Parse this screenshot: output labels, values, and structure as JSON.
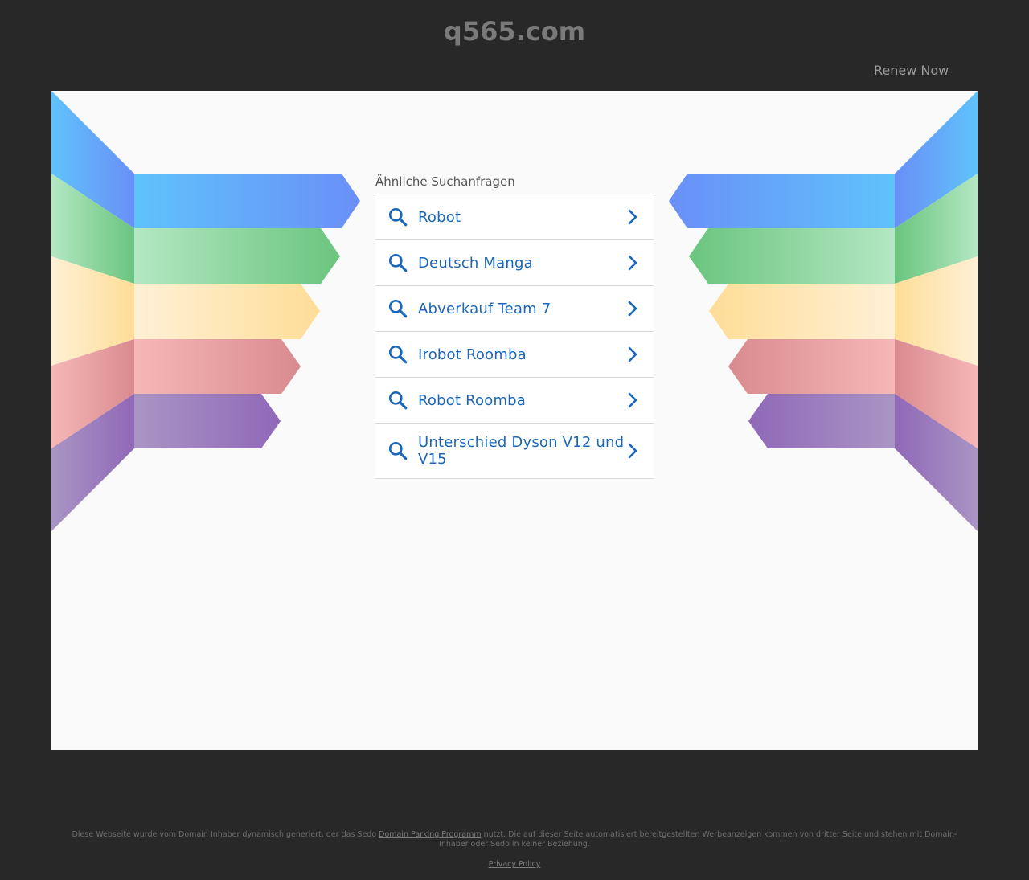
{
  "domain": "q565.com",
  "renew_label": "Renew Now",
  "related": {
    "heading": "Ähnliche Suchanfragen",
    "items": [
      {
        "label": "Robot"
      },
      {
        "label": "Deutsch Manga"
      },
      {
        "label": "Abverkauf Team 7"
      },
      {
        "label": "Irobot Roomba"
      },
      {
        "label": "Robot Roomba"
      },
      {
        "label": "Unterschied Dyson V12 und V15"
      }
    ]
  },
  "footer": {
    "text_before_link": "Diese Webseite wurde vom Domain Inhaber dynamisch generiert, der das Sedo ",
    "link_label": "Domain Parking Programm",
    "text_after_link": " nutzt. Die auf dieser Seite automatisiert bereitgestellten Werbeanzeigen kommen von dritter Seite und stehen mit Domain-Inhaber oder Sedo in keiner Beziehung.",
    "privacy_label": "Privacy Policy"
  },
  "colors": {
    "background": "#282828",
    "panel": "#fafafa",
    "link_blue": "#1a66b8",
    "band_blue": "#62a8f5",
    "band_green": "#7fcf8c",
    "band_yellow": "#fde3a8",
    "band_red": "#e9a3a3",
    "band_purple": "#a98ec2"
  },
  "icons": {
    "search": "search-icon",
    "chevron": "chevron-right-icon"
  }
}
